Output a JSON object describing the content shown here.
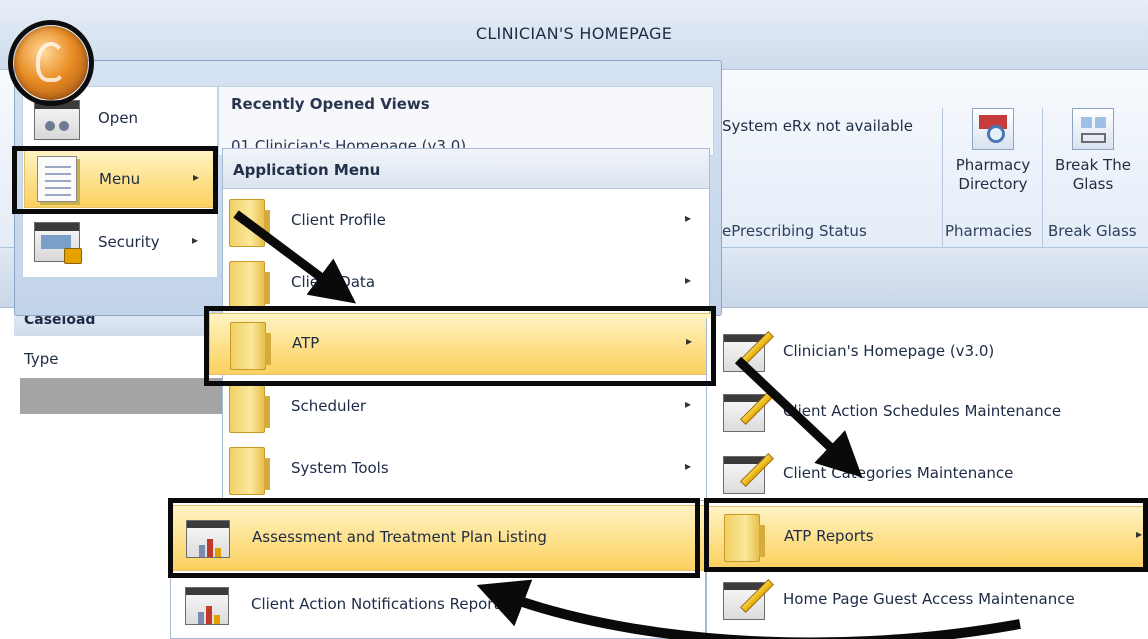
{
  "window": {
    "title": "CLINICIAN'S HOMEPAGE"
  },
  "ribbon": {
    "erx_status": "System eRx not available",
    "eprescribing_group_label": "ePrescribing Status",
    "pharmacy_directory_line1": "Pharmacy",
    "pharmacy_directory_line2": "Directory",
    "pharmacies_group_label": "Pharmacies",
    "break_glass_line1": "Break The",
    "break_glass_line2": "Glass",
    "break_glass_group_label": "Break Glass"
  },
  "left_pane": {
    "header": "Caseload",
    "type_label": "Type"
  },
  "app_dropdown": {
    "left_items": [
      {
        "label": "Open",
        "icon": "binoculars-window-icon"
      },
      {
        "label": "Menu",
        "icon": "document-list-icon",
        "arrow": "▸"
      },
      {
        "label": "Security",
        "icon": "lock-window-icon",
        "arrow": "▸"
      }
    ],
    "recent_header": "Recently Opened Views",
    "recent_items": [
      "01 Clinician's Homepage (v3.0)"
    ]
  },
  "application_menu": {
    "header": "Application Menu",
    "items": [
      {
        "label": "Client Profile",
        "arrow": "▸"
      },
      {
        "label": "Client Data",
        "arrow": "▸"
      },
      {
        "label": "ATP",
        "arrow": "▸"
      },
      {
        "label": "Scheduler",
        "arrow": "▸"
      },
      {
        "label": "System Tools",
        "arrow": "▸"
      }
    ]
  },
  "atp_menu": {
    "items": [
      {
        "label": "Clinician's Homepage (v3.0)"
      },
      {
        "label": "Client Action Schedules Maintenance"
      },
      {
        "label": "Client Categories Maintenance"
      },
      {
        "label": "ATP Reports",
        "arrow": "▸"
      },
      {
        "label": "Home Page Guest Access Maintenance"
      }
    ]
  },
  "atp_reports_menu": {
    "items": [
      {
        "label": "Assessment and Treatment Plan Listing"
      },
      {
        "label": "Client Action Notifications Report"
      }
    ]
  },
  "colors": {
    "highlight": "#fde08a",
    "ribbon": "#e4ecf7",
    "annotation": "#0a0a0a"
  }
}
